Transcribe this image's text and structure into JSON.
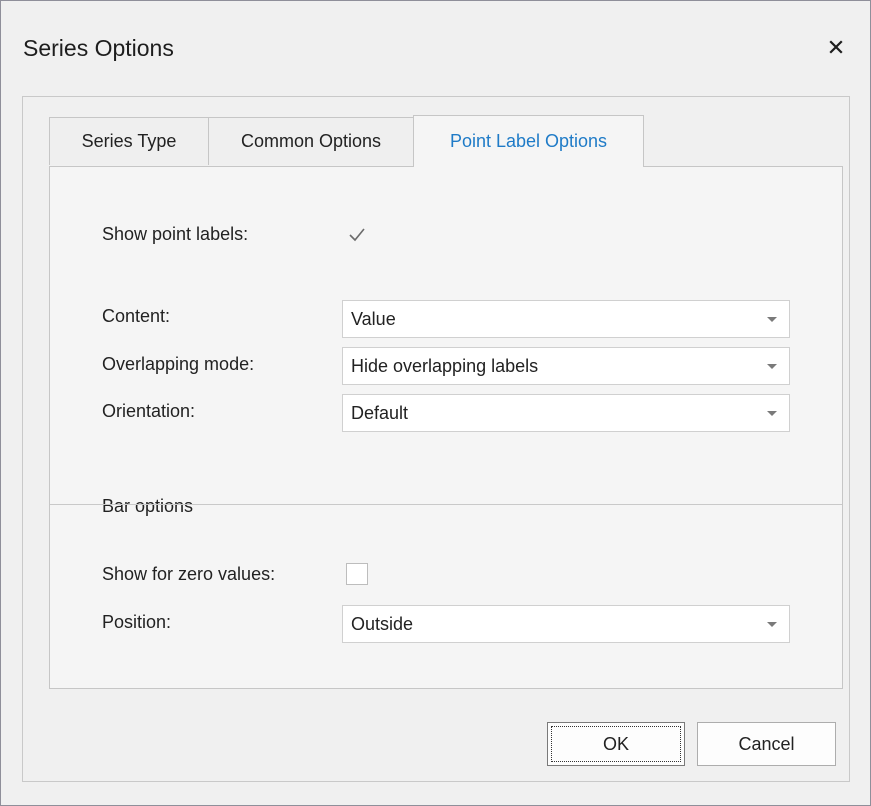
{
  "window": {
    "title": "Series Options"
  },
  "tabs": [
    {
      "label": "Series Type",
      "active": false
    },
    {
      "label": "Common Options",
      "active": false
    },
    {
      "label": "Point Label Options",
      "active": true
    }
  ],
  "point_labels": {
    "show_label": "Show point labels:",
    "show_checked": true,
    "content_label": "Content:",
    "content_value": "Value",
    "overlap_label": "Overlapping mode:",
    "overlap_value": "Hide overlapping labels",
    "orientation_label": "Orientation:",
    "orientation_value": "Default"
  },
  "bar_options": {
    "header": "Bar options",
    "zero_label": "Show for zero values:",
    "zero_checked": false,
    "position_label": "Position:",
    "position_value": "Outside"
  },
  "buttons": {
    "ok": "OK",
    "cancel": "Cancel"
  },
  "colors": {
    "active_tab_text": "#1f7bc7",
    "dialog_bg": "#f0f0f0"
  },
  "icons": {
    "close": "close-icon",
    "check": "checkmark-icon",
    "dropdown": "chevron-down-icon"
  }
}
